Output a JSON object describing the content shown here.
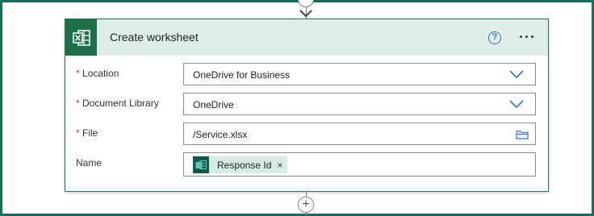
{
  "card": {
    "title": "Create worksheet",
    "help_glyph": "?",
    "more_glyph": "···"
  },
  "fields": [
    {
      "label": "Location",
      "required": true,
      "value": "OneDrive for Business",
      "control": "dropdown"
    },
    {
      "label": "Document Library",
      "required": true,
      "value": "OneDrive",
      "control": "dropdown"
    },
    {
      "label": "File",
      "required": true,
      "value": "/Service.xlsx",
      "control": "file-picker"
    },
    {
      "label": "Name",
      "required": false,
      "control": "token-input",
      "token": {
        "label": "Response Id",
        "remove_glyph": "×",
        "icon": "forms-icon"
      }
    }
  ],
  "connector": {
    "add_glyph": "+"
  },
  "colors": {
    "frame": "#196e5b",
    "header_bg": "#dfeee6",
    "excel_green": "#1d7047",
    "accent_blue": "#2b6fd6",
    "required_red": "#d13438",
    "token_bg": "#d6ebe6"
  }
}
